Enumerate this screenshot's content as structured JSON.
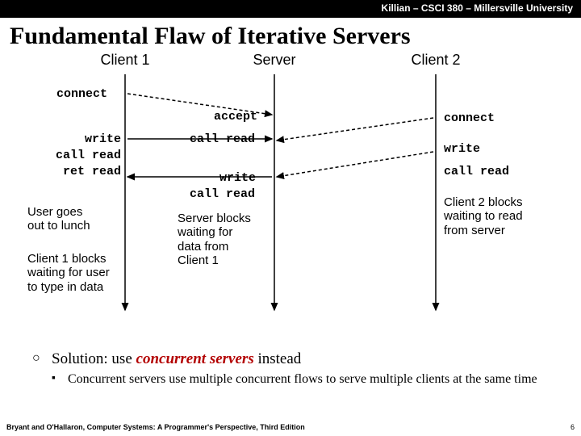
{
  "header": "Killian – CSCI 380 – Millersville University",
  "title": "Fundamental Flaw of Iterative Servers",
  "diagram": {
    "col_client1": "Client 1",
    "col_server": "Server",
    "col_client2": "Client 2",
    "c1": {
      "connect": "connect",
      "write": "write",
      "call_read": "call read",
      "ret_read": "ret read"
    },
    "srv": {
      "accept": "accept",
      "call_read1": "call read",
      "write": "write",
      "call_read2": "call read"
    },
    "c2": {
      "connect": "connect",
      "write": "write",
      "call_read": "call read"
    },
    "note_c1a_l1": "User goes",
    "note_c1a_l2": "out to lunch",
    "note_c1b_l1": "Client 1 blocks",
    "note_c1b_l2": "waiting for user",
    "note_c1b_l3": "to type in data",
    "note_srv_l1": "Server blocks",
    "note_srv_l2": "waiting for",
    "note_srv_l3": "data from",
    "note_srv_l4": "Client 1",
    "note_c2_l1": "Client 2 blocks",
    "note_c2_l2": "waiting to read",
    "note_c2_l3": "from server"
  },
  "bullet1_pre": "Solution: use ",
  "bullet1_emph": "concurrent servers",
  "bullet1_post": " instead",
  "bullet2": "Concurrent servers use multiple concurrent flows to serve multiple clients at the same time",
  "footer_left": "Bryant and O'Hallaron, Computer Systems: A Programmer's Perspective, Third Edition",
  "footer_right": "6"
}
